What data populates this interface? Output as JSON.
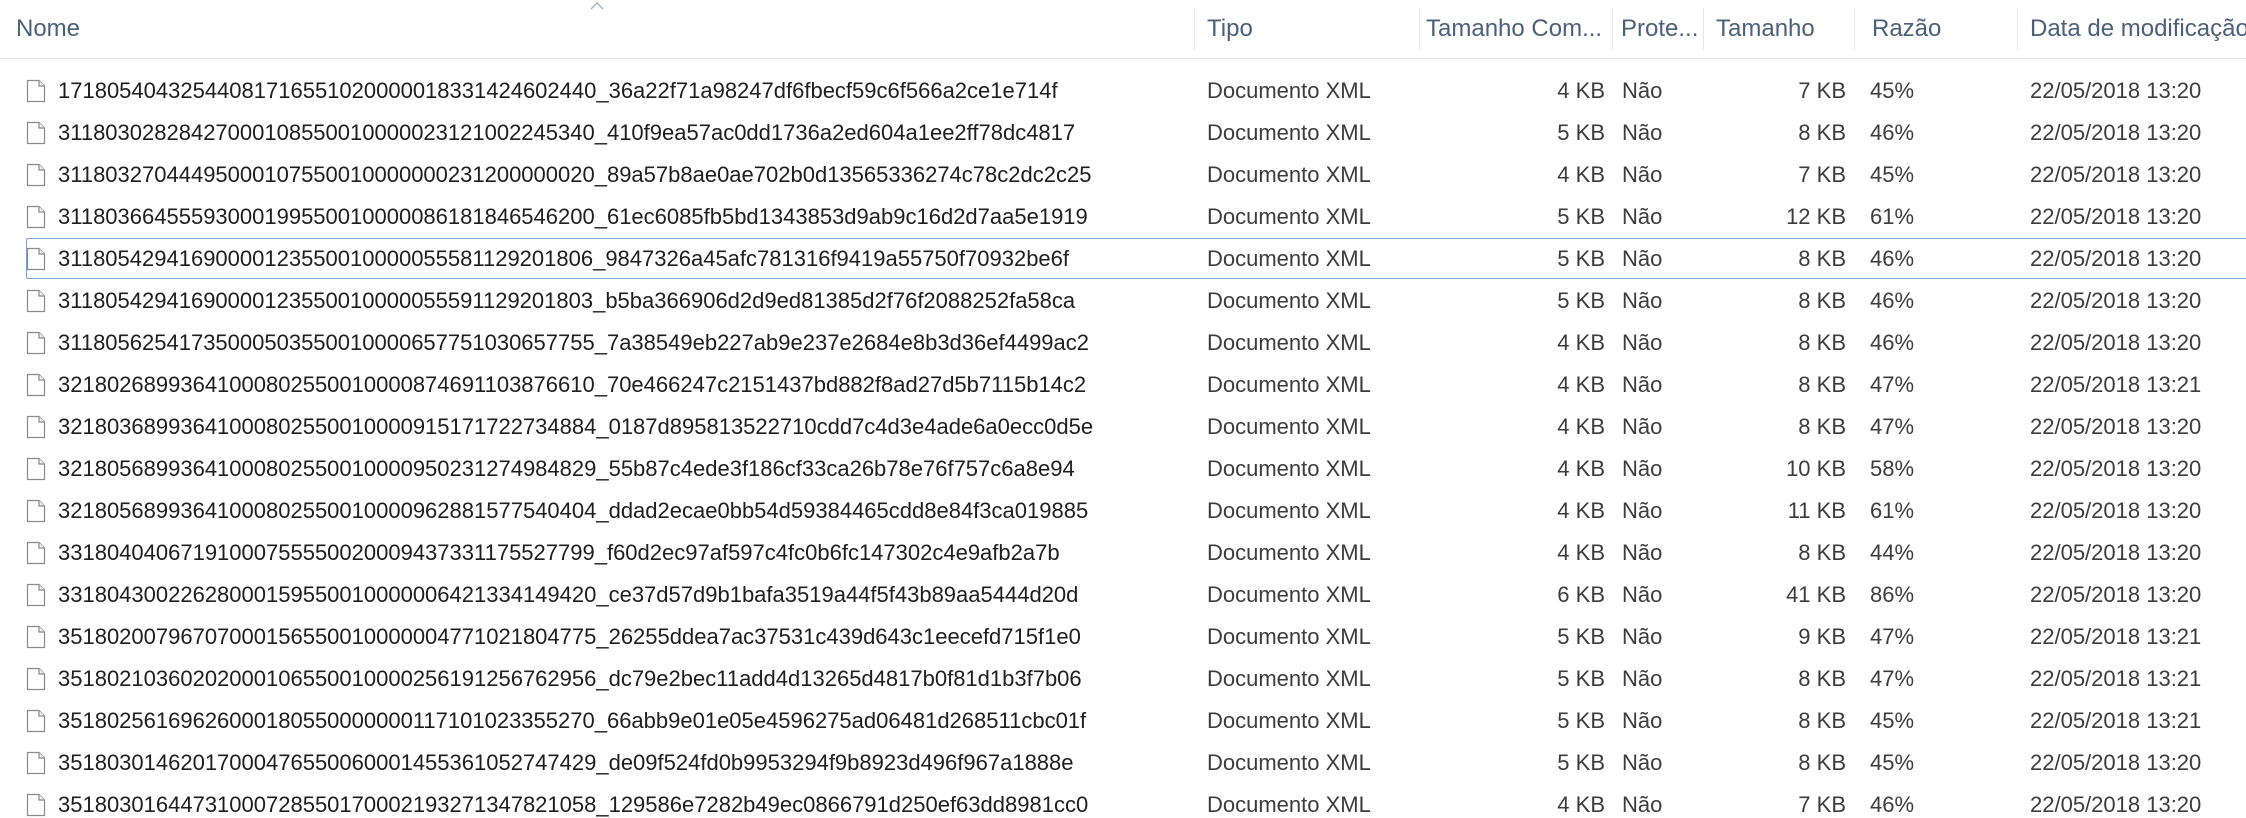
{
  "columns": {
    "name": "Nome",
    "type": "Tipo",
    "compressed_size": "Tamanho Com...",
    "protected": "Prote...",
    "size": "Tamanho",
    "ratio": "Razão",
    "modified": "Data de modificação"
  },
  "selected_row": 4,
  "rows": [
    {
      "name": "17180540432544081716551020000018331424602440_36a22f71a98247df6fbecf59c6f566a2ce1e714f",
      "type": "Documento XML",
      "compressed": "4 KB",
      "protected": "Não",
      "size": "7 KB",
      "ratio": "45%",
      "modified": "22/05/2018 13:20"
    },
    {
      "name": "31180302828427000108550010000023121002245340_410f9ea57ac0dd1736a2ed604a1ee2ff78dc4817",
      "type": "Documento XML",
      "compressed": "5 KB",
      "protected": "Não",
      "size": "8 KB",
      "ratio": "46%",
      "modified": "22/05/2018 13:20"
    },
    {
      "name": "31180327044495000107550010000000231200000020_89a57b8ae0ae702b0d13565336274c78c2dc2c25",
      "type": "Documento XML",
      "compressed": "4 KB",
      "protected": "Não",
      "size": "7 KB",
      "ratio": "45%",
      "modified": "22/05/2018 13:20"
    },
    {
      "name": "31180366455593000199550010000086181846546200_61ec6085fb5bd1343853d9ab9c16d2d7aa5e1919",
      "type": "Documento XML",
      "compressed": "5 KB",
      "protected": "Não",
      "size": "12 KB",
      "ratio": "61%",
      "modified": "22/05/2018 13:20"
    },
    {
      "name": "31180542941690000123550010000055581129201806_9847326a45afc781316f9419a55750f70932be6f",
      "type": "Documento XML",
      "compressed": "5 KB",
      "protected": "Não",
      "size": "8 KB",
      "ratio": "46%",
      "modified": "22/05/2018 13:20"
    },
    {
      "name": "31180542941690000123550010000055591129201803_b5ba366906d2d9ed81385d2f76f2088252fa58ca",
      "type": "Documento XML",
      "compressed": "5 KB",
      "protected": "Não",
      "size": "8 KB",
      "ratio": "46%",
      "modified": "22/05/2018 13:20"
    },
    {
      "name": "31180562541735000503550010000657751030657755_7a38549eb227ab9e237e2684e8b3d36ef4499ac2",
      "type": "Documento XML",
      "compressed": "4 KB",
      "protected": "Não",
      "size": "8 KB",
      "ratio": "46%",
      "modified": "22/05/2018 13:20"
    },
    {
      "name": "32180268993641000802550010000874691103876610_70e466247c2151437bd882f8ad27d5b7115b14c2",
      "type": "Documento XML",
      "compressed": "4 KB",
      "protected": "Não",
      "size": "8 KB",
      "ratio": "47%",
      "modified": "22/05/2018 13:21"
    },
    {
      "name": "32180368993641000802550010000915171722734884_0187d895813522710cdd7c4d3e4ade6a0ecc0d5e",
      "type": "Documento XML",
      "compressed": "4 KB",
      "protected": "Não",
      "size": "8 KB",
      "ratio": "47%",
      "modified": "22/05/2018 13:20"
    },
    {
      "name": "32180568993641000802550010000950231274984829_55b87c4ede3f186cf33ca26b78e76f757c6a8e94",
      "type": "Documento XML",
      "compressed": "4 KB",
      "protected": "Não",
      "size": "10 KB",
      "ratio": "58%",
      "modified": "22/05/2018 13:20"
    },
    {
      "name": "32180568993641000802550010000962881577540404_ddad2ecae0bb54d59384465cdd8e84f3ca019885",
      "type": "Documento XML",
      "compressed": "4 KB",
      "protected": "Não",
      "size": "11 KB",
      "ratio": "61%",
      "modified": "22/05/2018 13:20"
    },
    {
      "name": "33180404067191000755550020009437331175527799_f60d2ec97af597c4fc0b6fc147302c4e9afb2a7b",
      "type": "Documento XML",
      "compressed": "4 KB",
      "protected": "Não",
      "size": "8 KB",
      "ratio": "44%",
      "modified": "22/05/2018 13:20"
    },
    {
      "name": "33180430022628000159550010000006421334149420_ce37d57d9b1bafa3519a44f5f43b89aa5444d20d",
      "type": "Documento XML",
      "compressed": "6 KB",
      "protected": "Não",
      "size": "41 KB",
      "ratio": "86%",
      "modified": "22/05/2018 13:20"
    },
    {
      "name": "35180200796707000156550010000004771021804775_26255ddea7ac37531c439d643c1eecefd715f1e0",
      "type": "Documento XML",
      "compressed": "5 KB",
      "protected": "Não",
      "size": "9 KB",
      "ratio": "47%",
      "modified": "22/05/2018 13:21"
    },
    {
      "name": "35180210360202000106550010000256191256762956_dc79e2bec11add4d13265d4817b0f81d1b3f7b06",
      "type": "Documento XML",
      "compressed": "5 KB",
      "protected": "Não",
      "size": "8 KB",
      "ratio": "47%",
      "modified": "22/05/2018 13:21"
    },
    {
      "name": "35180256169626000180550000000117101023355270_66abb9e01e05e4596275ad06481d268511cbc01f",
      "type": "Documento XML",
      "compressed": "5 KB",
      "protected": "Não",
      "size": "8 KB",
      "ratio": "45%",
      "modified": "22/05/2018 13:21"
    },
    {
      "name": "35180301462017000476550060001455361052747429_de09f524fd0b9953294f9b8923d496f967a1888e",
      "type": "Documento XML",
      "compressed": "5 KB",
      "protected": "Não",
      "size": "8 KB",
      "ratio": "45%",
      "modified": "22/05/2018 13:20"
    },
    {
      "name": "35180301644731000728550170002193271347821058_129586e7282b49ec0866791d250ef63dd8981cc0",
      "type": "Documento XML",
      "compressed": "4 KB",
      "protected": "Não",
      "size": "7 KB",
      "ratio": "46%",
      "modified": "22/05/2018 13:20"
    }
  ]
}
